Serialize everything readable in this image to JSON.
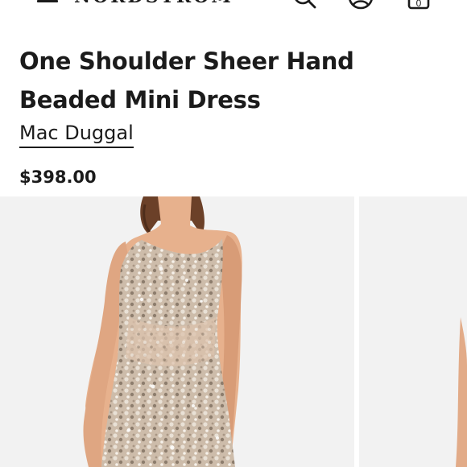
{
  "header": {
    "brand": "NORDSTROM",
    "icons": [
      "menu-icon",
      "search-icon",
      "account-icon",
      "shopping-bag-icon"
    ],
    "bag_count": "0"
  },
  "product": {
    "title": "One Shoulder Sheer Hand Beaded Mini Dress",
    "brand": "Mac Duggal",
    "price": "$398.00"
  },
  "gallery": {
    "images": [
      "model-front-photo",
      "model-alt-photo"
    ]
  },
  "colors": {
    "text": "#1b1b1b",
    "photo_background": "#f2f2f2",
    "dress_sequin": "#c9b8a6",
    "skin": "#e7b18d",
    "hair": "#6b4028"
  }
}
